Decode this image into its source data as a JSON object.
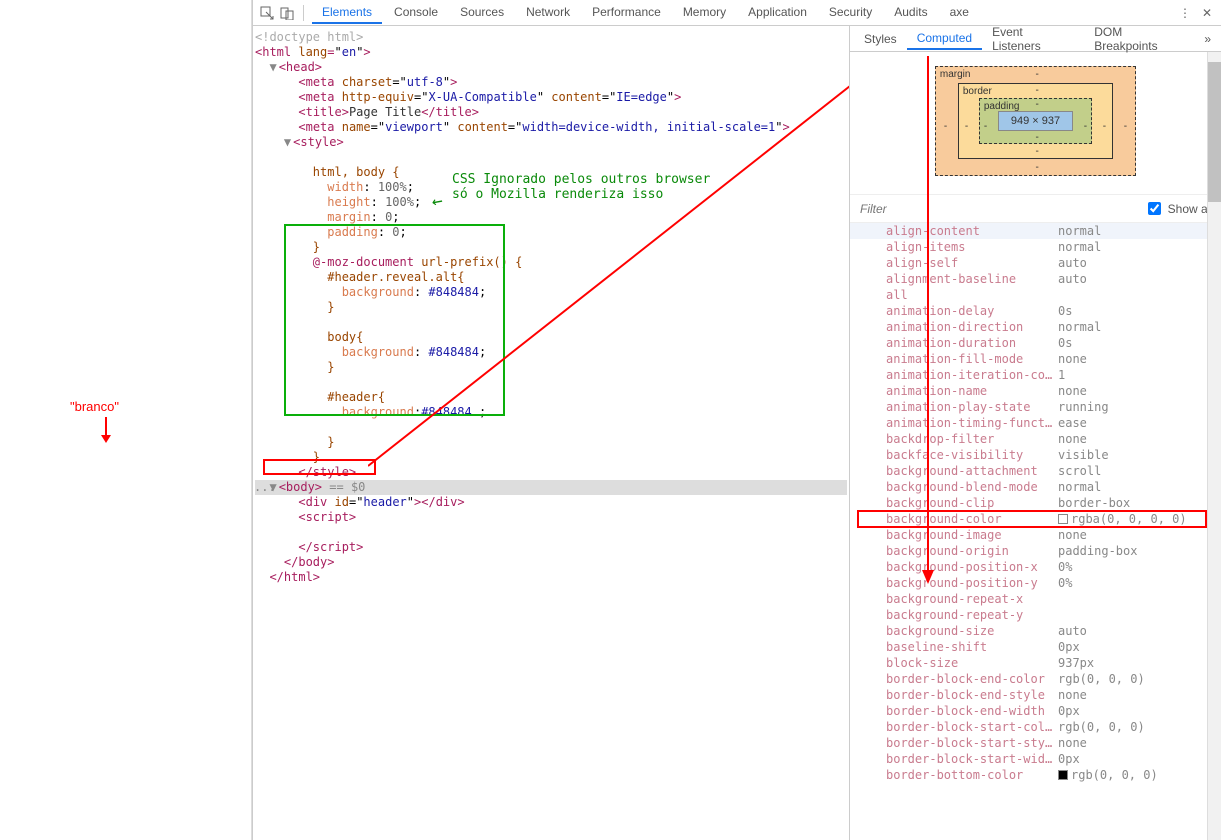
{
  "left_annotation": "\"branco\"",
  "toolbar": {
    "tabs": [
      "Elements",
      "Console",
      "Sources",
      "Network",
      "Performance",
      "Memory",
      "Application",
      "Security",
      "Audits",
      "axe"
    ],
    "active": "Elements"
  },
  "green_annotation_line1": "CSS Ignorado pelos outros browser",
  "green_annotation_line2": "só o Mozilla renderiza isso",
  "box_model": {
    "content": "949 × 937",
    "margin": "margin",
    "border": "border",
    "padding": "padding"
  },
  "code": {
    "doctype": "<!doctype html>",
    "html_open": "<html lang=\"en\">",
    "head_open": "<head>",
    "meta1_tag": "meta",
    "meta1_a": "charset",
    "meta1_v": "utf-8",
    "meta2_tag": "meta",
    "meta2_a1": "http-equiv",
    "meta2_v1": "X-UA-Compatible",
    "meta2_a2": "content",
    "meta2_v2": "IE=edge",
    "title_tag": "title",
    "title_text": "Page Title",
    "meta3_tag": "meta",
    "meta3_a1": "name",
    "meta3_v1": "viewport",
    "meta3_a2": "content",
    "meta3_v2": "width=device-width, initial-scale=1",
    "style_open": "<style>",
    "r1": "html, body {",
    "p1": "width",
    "p1v": "100%",
    "p2": "height",
    "p2v": "100%",
    "p3": "margin",
    "p3v": "0",
    "p4": "padding",
    "p4v": "0",
    "rc": "}",
    "moz": "@-moz-document",
    "mozarg": "url-prefix() {",
    "sel1": "#header.reveal.alt{",
    "bgp": "background",
    "bgv": "#848484",
    "sel2": "body{",
    "sel3": "#header{",
    "style_close": "</style>",
    "body_open": "<body>",
    "body_suffix": " == $0",
    "div_header": "div",
    "div_id": "id",
    "div_idv": "header",
    "script_open": "<script>",
    "script_close": "</script>",
    "body_close": "</body>",
    "html_close": "</html>"
  },
  "sidebar": {
    "tabs": [
      "Styles",
      "Computed",
      "Event Listeners",
      "DOM Breakpoints"
    ],
    "active": "Computed",
    "filter_placeholder": "Filter",
    "show_all": "Show all",
    "props": [
      {
        "n": "align-content",
        "v": "normal",
        "hl": true
      },
      {
        "n": "align-items",
        "v": "normal"
      },
      {
        "n": "align-self",
        "v": "auto"
      },
      {
        "n": "alignment-baseline",
        "v": "auto"
      },
      {
        "n": "all",
        "v": ""
      },
      {
        "n": "animation-delay",
        "v": "0s"
      },
      {
        "n": "animation-direction",
        "v": "normal"
      },
      {
        "n": "animation-duration",
        "v": "0s"
      },
      {
        "n": "animation-fill-mode",
        "v": "none"
      },
      {
        "n": "animation-iteration-count",
        "v": "1"
      },
      {
        "n": "animation-name",
        "v": "none"
      },
      {
        "n": "animation-play-state",
        "v": "running"
      },
      {
        "n": "animation-timing-function",
        "v": "ease"
      },
      {
        "n": "backdrop-filter",
        "v": "none"
      },
      {
        "n": "backface-visibility",
        "v": "visible"
      },
      {
        "n": "background-attachment",
        "v": "scroll"
      },
      {
        "n": "background-blend-mode",
        "v": "normal"
      },
      {
        "n": "background-clip",
        "v": "border-box"
      },
      {
        "n": "background-color",
        "v": "rgba(0, 0, 0, 0)",
        "swatch": "#ffffff00",
        "boxed": true
      },
      {
        "n": "background-image",
        "v": "none"
      },
      {
        "n": "background-origin",
        "v": "padding-box"
      },
      {
        "n": "background-position-x",
        "v": "0%"
      },
      {
        "n": "background-position-y",
        "v": "0%"
      },
      {
        "n": "background-repeat-x",
        "v": ""
      },
      {
        "n": "background-repeat-y",
        "v": ""
      },
      {
        "n": "background-size",
        "v": "auto"
      },
      {
        "n": "baseline-shift",
        "v": "0px"
      },
      {
        "n": "block-size",
        "v": "937px"
      },
      {
        "n": "border-block-end-color",
        "v": "rgb(0, 0, 0)"
      },
      {
        "n": "border-block-end-style",
        "v": "none"
      },
      {
        "n": "border-block-end-width",
        "v": "0px"
      },
      {
        "n": "border-block-start-color",
        "v": "rgb(0, 0, 0)"
      },
      {
        "n": "border-block-start-style",
        "v": "none"
      },
      {
        "n": "border-block-start-width",
        "v": "0px"
      },
      {
        "n": "border-bottom-color",
        "v": "rgb(0, 0, 0)",
        "swatch": "#000"
      }
    ]
  }
}
